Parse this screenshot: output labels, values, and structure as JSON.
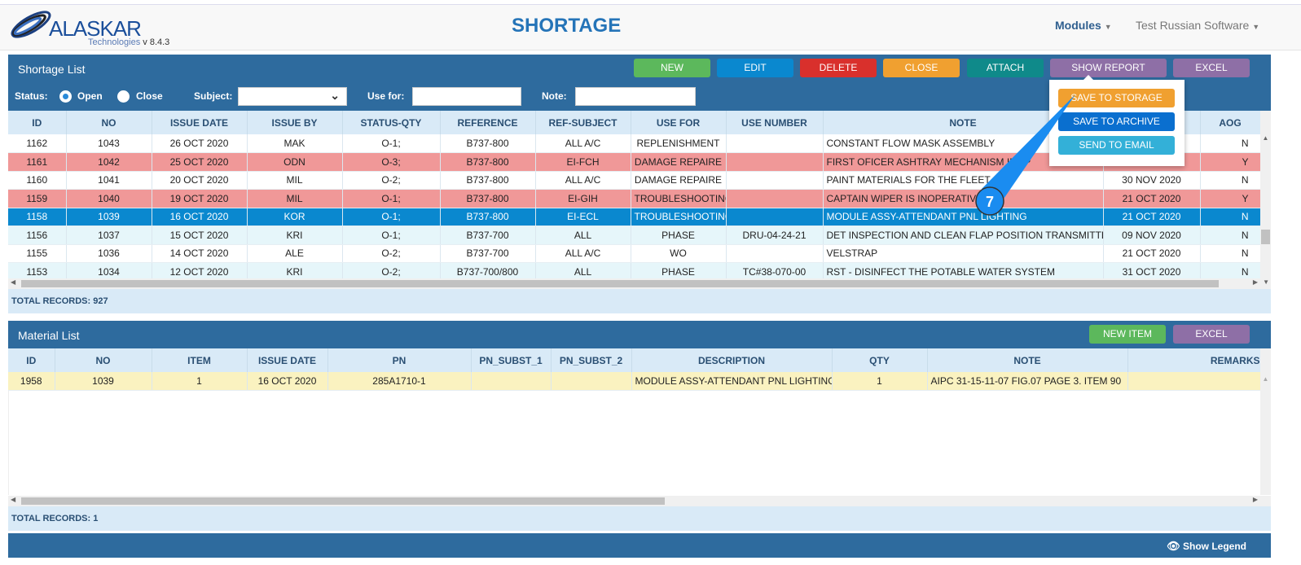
{
  "app": {
    "logo": "ALASKAR",
    "logo_sub": "Technologies",
    "version": "v 8.4.3",
    "title": "SHORTAGE",
    "modules": "Modules",
    "user": "Test Russian Software"
  },
  "shortage": {
    "title": "Shortage List",
    "buttons": [
      {
        "label": "NEW",
        "color": "#5cb85c"
      },
      {
        "label": "EDIT",
        "color": "#0a88cf"
      },
      {
        "label": "DELETE",
        "color": "#d9302c"
      },
      {
        "label": "CLOSE",
        "color": "#f0a030"
      },
      {
        "label": "ATTACH",
        "color": "#0f8a8a"
      },
      {
        "label": "SHOW REPORT",
        "color": "#8e6fa6"
      },
      {
        "label": "EXCEL",
        "color": "#8e6fa6"
      }
    ],
    "report_menu": [
      {
        "label": "SAVE TO STORAGE",
        "color": "#f0a030"
      },
      {
        "label": "SAVE TO ARCHIVE",
        "color": "#0a6fcf"
      },
      {
        "label": "SEND TO EMAIL",
        "color": "#33b0d8"
      }
    ],
    "filter": {
      "status_label": "Status:",
      "open": "Open",
      "close": "Close",
      "subject_label": "Subject:",
      "subject_value": "",
      "use_for_label": "Use for:",
      "use_for_value": "",
      "note_label": "Note:",
      "note_value": ""
    },
    "columns": [
      "ID",
      "NO",
      "ISSUE DATE",
      "ISSUE BY",
      "STATUS-QTY",
      "REFERENCE",
      "REF-SUBJECT",
      "USE FOR",
      "USE NUMBER",
      "NOTE",
      "",
      "AOG"
    ],
    "rows": [
      {
        "style": "white",
        "cells": [
          "1162",
          "1043",
          "26 OCT 2020",
          "MAK",
          "O-1;",
          "B737-800",
          "ALL A/C",
          "REPLENISHMENT",
          "",
          "CONSTANT FLOW MASK ASSEMBLY",
          "",
          "N"
        ]
      },
      {
        "style": "pink",
        "cells": [
          "1161",
          "1042",
          "25 OCT 2020",
          "ODN",
          "O-3;",
          "B737-800",
          "EI-FCH",
          "DAMAGE REPAIRE",
          "",
          "FIRST OFICER ASHTRAY MECHANISM INOP",
          "",
          "Y"
        ]
      },
      {
        "style": "white",
        "cells": [
          "1160",
          "1041",
          "20 OCT 2020",
          "MIL",
          "O-2;",
          "B737-800",
          "ALL A/C",
          "DAMAGE REPAIRE",
          "",
          "PAINT MATERIALS FOR THE FLEET",
          "30 NOV 2020",
          "N"
        ]
      },
      {
        "style": "pink",
        "cells": [
          "1159",
          "1040",
          "19 OCT 2020",
          "MIL",
          "O-1;",
          "B737-800",
          "EI-GIH",
          "TROUBLESHOOTING",
          "",
          "CAPTAIN WIPER IS INOPERATIVE",
          "21 OCT 2020",
          "Y"
        ]
      },
      {
        "style": "sel",
        "cells": [
          "1158",
          "1039",
          "16 OCT 2020",
          "KOR",
          "O-1;",
          "B737-800",
          "EI-ECL",
          "TROUBLESHOOTING",
          "",
          "MODULE ASSY-ATTENDANT PNL LIGHTING",
          "21 OCT 2020",
          "N"
        ]
      },
      {
        "style": "cyan",
        "cells": [
          "1156",
          "1037",
          "15 OCT 2020",
          "KRI",
          "O-1;",
          "B737-700",
          "ALL",
          "PHASE",
          "DRU-04-24-21",
          "DET INSPECTION AND CLEAN FLAP POSITION TRANSMITTER",
          "09 NOV 2020",
          "N"
        ]
      },
      {
        "style": "white",
        "cells": [
          "1155",
          "1036",
          "14 OCT 2020",
          "ALE",
          "O-2;",
          "B737-700",
          "ALL A/C",
          "WO",
          "",
          "VELSTRAP",
          "21 OCT 2020",
          "N"
        ]
      },
      {
        "style": "cyan",
        "cells": [
          "1153",
          "1034",
          "12 OCT 2020",
          "KRI",
          "O-2;",
          "B737-700/800",
          "ALL",
          "PHASE",
          "TC#38-070-00",
          "RST - DISINFECT THE POTABLE WATER SYSTEM",
          "31 OCT 2020",
          "N"
        ]
      }
    ],
    "total": "TOTAL RECORDS: 927"
  },
  "material": {
    "title": "Material List",
    "buttons": [
      {
        "label": "NEW ITEM",
        "color": "#5cb85c"
      },
      {
        "label": "EXCEL",
        "color": "#8e6fa6"
      }
    ],
    "columns": [
      "ID",
      "NO",
      "ITEM",
      "ISSUE DATE",
      "PN",
      "PN_SUBST_1",
      "PN_SUBST_2",
      "DESCRIPTION",
      "QTY",
      "NOTE",
      "REMARKS"
    ],
    "rows": [
      {
        "style": "yellow",
        "cells": [
          "1958",
          "1039",
          "1",
          "16 OCT 2020",
          "285A1710-1",
          "",
          "",
          "MODULE ASSY-ATTENDANT PNL LIGHTING",
          "1",
          "AIPC 31-15-11-07 FIG.07 PAGE 3. ITEM 90",
          ""
        ]
      }
    ],
    "total": "TOTAL RECORDS: 1"
  },
  "footer": {
    "show_legend": "Show Legend"
  },
  "annotation": {
    "step": "7",
    "color": "#1a8cf0"
  }
}
